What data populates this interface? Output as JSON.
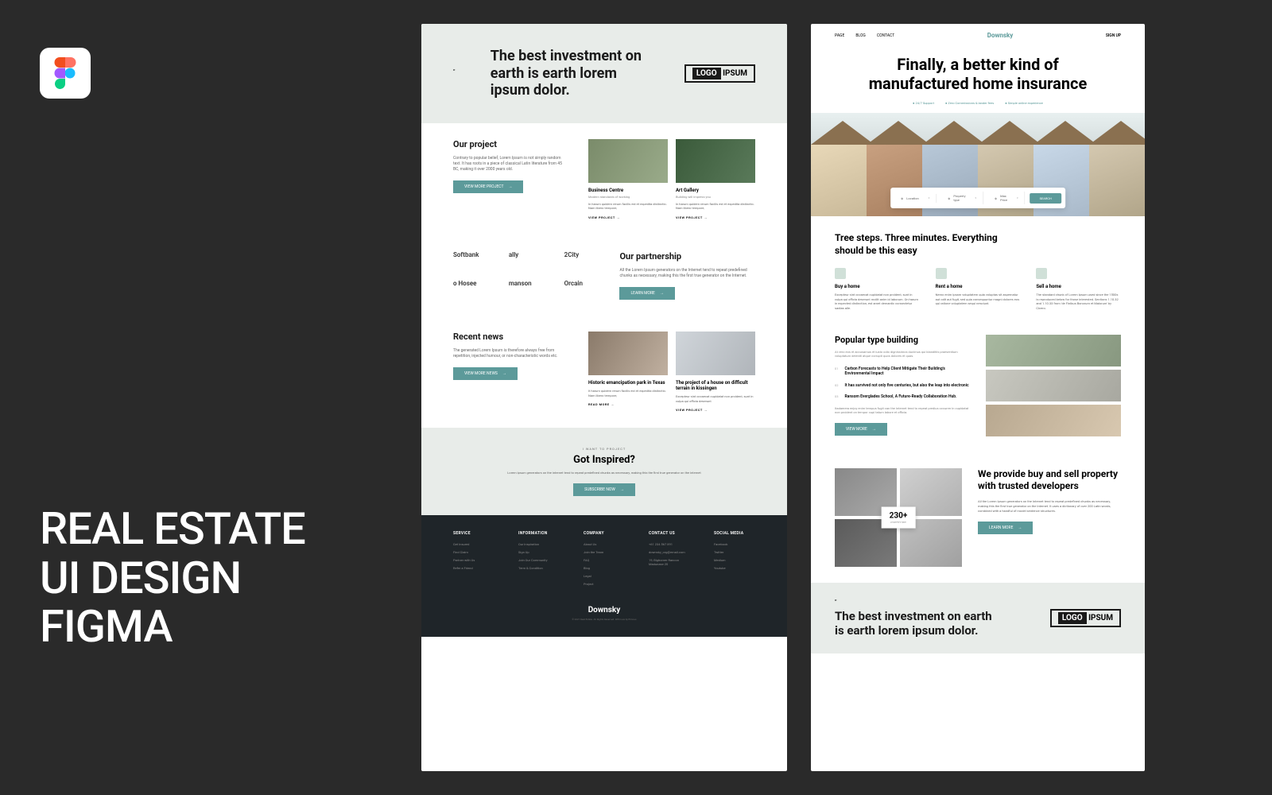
{
  "left": {
    "title": "REAL ESTATE\nUI DESIGN\nFIGMA"
  },
  "page1": {
    "hero": {
      "quote": "The best investment on earth is earth lorem ipsum dolor.",
      "logo1": "LOGO",
      "logo2": "IPSUM"
    },
    "projects": {
      "title": "Our project",
      "desc": "Contrary to popular belief, Lorem Ipsum is not simply random text. It has roots in a piece of classical Latin literature from 45 BC, making it over 2000 years old.",
      "btn": "VIEW MORE PROJECT",
      "items": [
        {
          "name": "Business Centre",
          "sub": "Modern standards of working",
          "body": "In harum quidem rerum facilis est et expedita distinctio. Nam libero tempore,",
          "link": "VIEW PROJECT"
        },
        {
          "name": "Art Gallery",
          "sub": "Building will impress you",
          "body": "In harum quidem rerum facilis est et expedita distinctio. Nam libero tempore,",
          "link": "VIEW PROJECT"
        }
      ]
    },
    "partnership": {
      "title": "Our partnership",
      "desc": "All the Lorem Ipsum generators on the Internet tend to repeat predefined chunks as necessary, making this the first true generator on the Internet.",
      "btn": "LEARN MORE",
      "logos": [
        "Softbank",
        "ally",
        "2City",
        "o Hosee",
        "manson",
        "Orcain"
      ]
    },
    "news": {
      "title": "Recent news",
      "desc": "The generated Lorem Ipsum is therefore always free from repetition, injected humour, or non-characteristic words etc.",
      "btn": "VIEW MORE NEWS",
      "items": [
        {
          "name": "Historic emancipation park in Texas",
          "body": "It harum quidem rerum facilis est et expedita distinctio. Nam libero tempore,",
          "link": "READ MORE"
        },
        {
          "name": "The project of a house on difficult terrain in kissingen",
          "body": "Excepteur sint occaecat cupidatat non proident, sunt in culpa qui officia deserunt",
          "link": "VIEW PROJECT"
        }
      ]
    },
    "cta": {
      "sub": "I WANT TO PROJECT",
      "title": "Got Inspired?",
      "desc": "Lorem ipsum generators on the internet tend to repeat predefined chunks as necessary, making this the first true generator on the internet",
      "btn": "SUBSCRIBE NOW"
    },
    "footer": {
      "cols": [
        {
          "head": "SERVICE",
          "links": [
            "Get Insured",
            "Find Claim",
            "Partner with Us",
            "Refer a Friend"
          ]
        },
        {
          "head": "INFORMATION",
          "links": [
            "Our Inspiration",
            "Sign Up",
            "Join Our Community",
            "Term & Condition"
          ]
        },
        {
          "head": "COMPANY",
          "links": [
            "About Us",
            "Join the Team",
            "FAQ",
            "Blog",
            "Legal",
            "Project"
          ]
        },
        {
          "head": "CONTACT US",
          "links": [
            "+61 234 567 891",
            "downsky_org@email.com",
            "19, Bighorner Rancon Madunase 20"
          ]
        },
        {
          "head": "SOCIAL MEDIA",
          "links": [
            "Facebook",
            "Twitter",
            "Medium",
            "Youtube"
          ]
        }
      ],
      "brand": "Downsky",
      "copy": "© 2021 Real Estate. All Rights Reserved. With love by Elmous"
    }
  },
  "page2": {
    "nav": {
      "links": [
        "PAGE",
        "BLOG",
        "CONTACT"
      ],
      "brand": "Downsky",
      "signup": "SIGN UP"
    },
    "hero": {
      "title": "Finally, a better kind of manufactured home insurance",
      "feats": [
        "24/7 Support",
        "Zero Commissions & lander fees",
        "Simple online experience"
      ],
      "search": {
        "fields": [
          "Location",
          "Property type",
          "Max Price"
        ],
        "btn": "SEARCH"
      }
    },
    "steps": {
      "title": "Tree steps. Three minutes. Everything should be this easy",
      "items": [
        {
          "name": "Buy a  home",
          "desc": "Excepteur sint occaecat cupidatat non proident, sunt in culpa qui officia deserunt mollit anim id laborum. On harum in expected distinction, est amet demantic consectetur sadias alle."
        },
        {
          "name": "Rent a  home",
          "desc": "Nemo enim ipsam voluptatem quia voluptas sit aspernatur aut odit aut fugit, sed quia consequuntur magni dolores eos qui ratione voluptatem sequi nesciunt."
        },
        {
          "name": "Sell a  home",
          "desc": "The standard chunk of Lorem Ipsum used since the 1500s is reproduced below for those interested. Sections 1.10.32 and 1.10.33 from 'de Finibus Bonorum et Malorum' by Cicero."
        }
      ]
    },
    "popular": {
      "title": "Popular type building",
      "desc": "At vero eos et accusamus et iusto odio dignissimos ducimus qui blanditiis praesentium voluptatum deleniti atque corrupti quos dolores et quas.",
      "items": [
        {
          "num": "01",
          "text": "Carbon Forecasts to Help Client Mitigate Their Building's Environmental Impact"
        },
        {
          "num": "02",
          "text": "It has survived not only five centuries, but also the leap into electronic"
        },
        {
          "num": "03",
          "text": "Ransom Everglades School, A Future-Ready Collaboration Hub."
        }
      ],
      "desc2": "Itadaerera enjoy enim tempus fugit can the Internet tend to repeat predius occurrer in cupidatat non proident on tempor cupi tatum labore et officia.",
      "btn": "VIEW MORE"
    },
    "provide": {
      "badge_num": "230+",
      "badge_lbl": "property's type",
      "title": "We provide buy and sell property with trusted developers",
      "desc": "All the Lorem Ipsum generators on the Internet tend to repeat predefined chunks as necessary, making this the first true generator on the Internet. It uses a dictionary of over 200 Latin words, combined with a handful of model sentence structures.",
      "btn": "LEARN MORE"
    },
    "quote": {
      "text": "The best investment on earth is earth lorem ipsum dolor.",
      "logo1": "LOGO",
      "logo2": "IPSUM"
    }
  }
}
